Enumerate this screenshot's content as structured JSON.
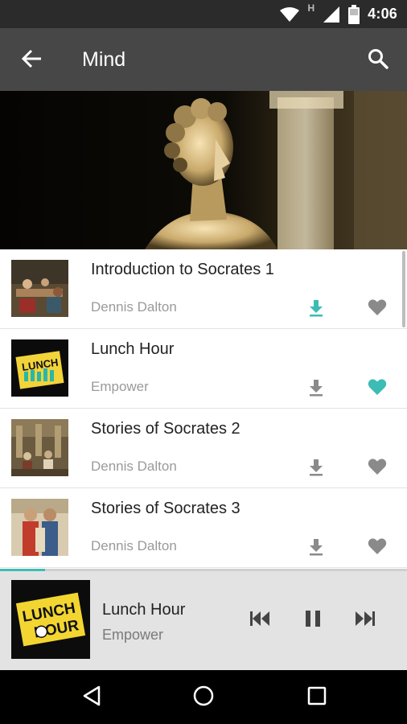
{
  "status_bar": {
    "time": "4:06",
    "network_label": "H",
    "icons": [
      "wifi-icon",
      "network-type-icon",
      "signal-icon",
      "battery-icon"
    ]
  },
  "app_bar": {
    "title": "Mind",
    "back_icon": "arrow-back-icon",
    "search_icon": "search-icon"
  },
  "hero": {
    "image": "classical-statue-bust"
  },
  "colors": {
    "accent": "#3cbcb4",
    "app_bar": "#474747",
    "status_bar": "#2b2b2b",
    "icon_grey": "#8a8a8a",
    "player_bg": "#e3e3e3"
  },
  "tracks": [
    {
      "title": "Introduction to Socrates 1",
      "author": "Dennis Dalton",
      "downloaded": true,
      "favorited": false,
      "thumb": "socrates-painting"
    },
    {
      "title": "Lunch Hour",
      "author": "Empower",
      "downloaded": false,
      "favorited": true,
      "thumb": "lunch-hour-logo"
    },
    {
      "title": "Stories of Socrates 2",
      "author": "Dennis Dalton",
      "downloaded": false,
      "favorited": false,
      "thumb": "athens-painting"
    },
    {
      "title": "Stories of Socrates 3",
      "author": "Dennis Dalton",
      "downloaded": false,
      "favorited": false,
      "thumb": "plato-aristotle-painting"
    }
  ],
  "player": {
    "title": "Lunch Hour",
    "artist": "Empower",
    "cover_text_top": "LUNCH",
    "cover_text_bottom": "HOUR",
    "progress": 0.11,
    "controls": [
      "skip-previous-icon",
      "pause-icon",
      "skip-next-icon"
    ]
  },
  "nav_bar": {
    "icons": [
      "nav-back-icon",
      "nav-home-icon",
      "nav-recents-icon"
    ]
  }
}
